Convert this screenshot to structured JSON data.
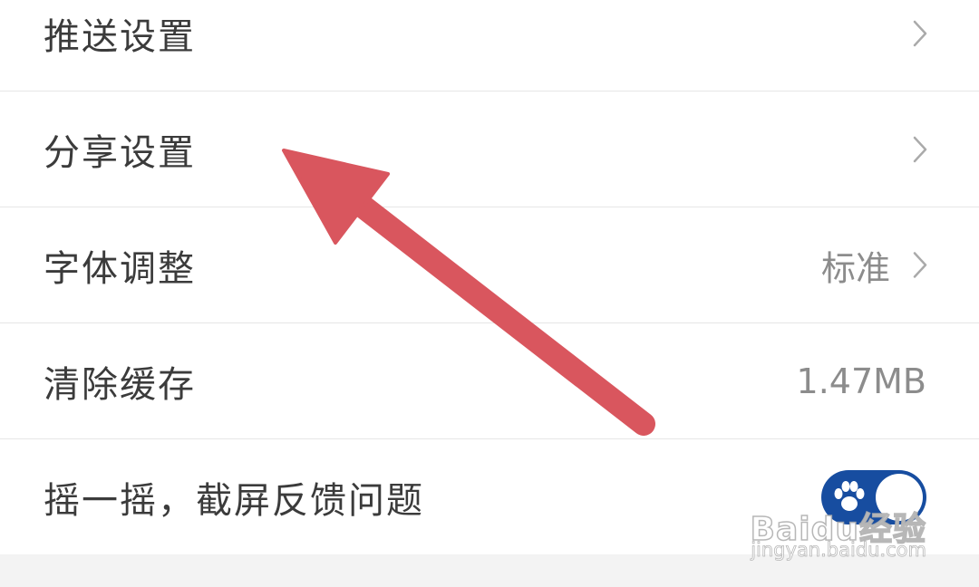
{
  "settings": {
    "items": [
      {
        "label": "推送设置",
        "value": ""
      },
      {
        "label": "分享设置",
        "value": ""
      },
      {
        "label": "字体调整",
        "value": "标准"
      },
      {
        "label": "清除缓存",
        "value": "1.47MB"
      },
      {
        "label": "摇一摇，截屏反馈问题",
        "value": "",
        "toggle_on": true
      }
    ]
  },
  "icons": {
    "row_chevron": "chevron-right-icon",
    "toggle_badge": "paw-icon",
    "annotation": "red-arrow"
  },
  "colors": {
    "toggle_on": "#174da0",
    "annotation_arrow": "#d9565e",
    "label_text": "#3b3b3b",
    "value_text": "#8c8c8c",
    "divider": "#e6e6e6",
    "footer_background": "#f3f3f3"
  },
  "watermark": {
    "brand": "Baidu经验",
    "url": "jingyan.baidu.com"
  }
}
